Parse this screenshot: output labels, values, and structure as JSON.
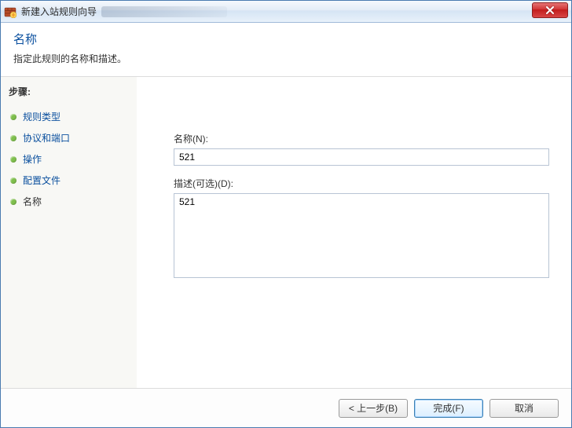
{
  "window": {
    "title": "新建入站规则向导"
  },
  "header": {
    "title": "名称",
    "subtitle": "指定此规则的名称和描述。"
  },
  "sidebar": {
    "steps_label": "步骤:",
    "items": [
      {
        "label": "规则类型",
        "current": false
      },
      {
        "label": "协议和端口",
        "current": false
      },
      {
        "label": "操作",
        "current": false
      },
      {
        "label": "配置文件",
        "current": false
      },
      {
        "label": "名称",
        "current": true
      }
    ]
  },
  "main": {
    "name_label": "名称(N):",
    "name_value": "521",
    "desc_label": "描述(可选)(D):",
    "desc_value": "521"
  },
  "footer": {
    "back": "< 上一步(B)",
    "finish": "完成(F)",
    "cancel": "取消"
  }
}
